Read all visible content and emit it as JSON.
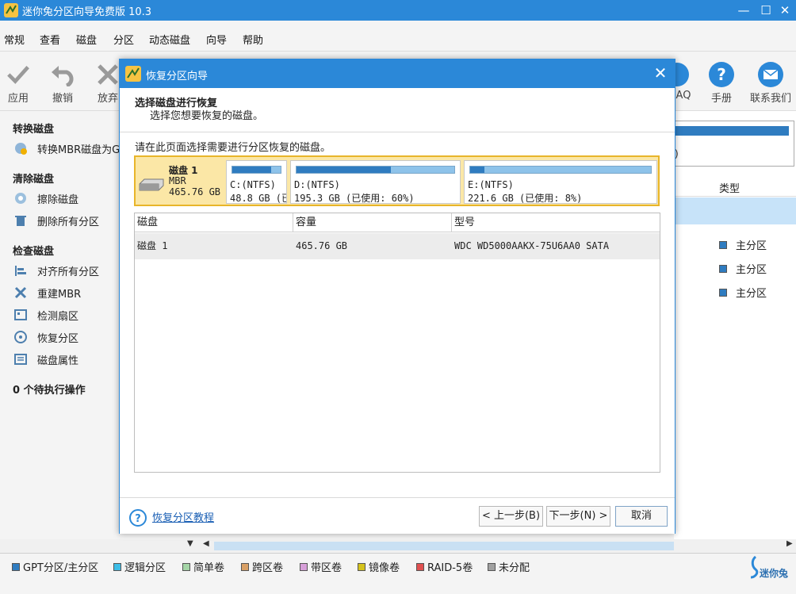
{
  "app": {
    "title": "迷你兔分区向导免费版 10.3"
  },
  "menu": [
    "常规",
    "查看",
    "磁盘",
    "分区",
    "动态磁盘",
    "向导",
    "帮助"
  ],
  "toolbar": {
    "apply": "应用",
    "undo": "撤销",
    "discard": "放弃",
    "faq": "AQ",
    "manual": "手册",
    "contact": "联系我们"
  },
  "sidebar": {
    "section_convert": "转换磁盘",
    "item_convert_mbr": "转换MBR磁盘为GPT",
    "section_clean": "清除磁盘",
    "item_wipe": "擦除磁盘",
    "item_delete_all": "删除所有分区",
    "section_check": "检查磁盘",
    "item_align": "对齐所有分区",
    "item_rebuild": "重建MBR",
    "item_surface": "检测扇区",
    "item_recover": "恢复分区",
    "item_props": "磁盘属性",
    "pending": "0 个待执行操作"
  },
  "right_panel": {
    "col_type": "类型",
    "size_fragment": ")",
    "rows": [
      "主分区",
      "主分区",
      "主分区"
    ]
  },
  "legend": [
    {
      "label": "GPT分区/主分区",
      "color": "#2f7cc0"
    },
    {
      "label": "逻辑分区",
      "color": "#3dbde6"
    },
    {
      "label": "简单卷",
      "color": "#a5d6a7"
    },
    {
      "label": "跨区卷",
      "color": "#d9a066"
    },
    {
      "label": "带区卷",
      "color": "#d79fd9"
    },
    {
      "label": "镜像卷",
      "color": "#d4c21c"
    },
    {
      "label": "RAID-5卷",
      "color": "#e05050"
    },
    {
      "label": "未分配",
      "color": "#a0a0a0"
    }
  ],
  "brand": "迷你兔",
  "dialog": {
    "title": "恢复分区向导",
    "heading": "选择磁盘进行恢复",
    "subheading": "选择您想要恢复的磁盘。",
    "instruction": "请在此页面选择需要进行分区恢复的磁盘。",
    "disk": {
      "name": "磁盘 1",
      "type": "MBR",
      "size": "465.76 GB",
      "partitions": [
        {
          "name": "C:(NTFS)",
          "info": "48.8 GB (已",
          "used_fraction": 0.8
        },
        {
          "name": "D:(NTFS)",
          "info": "195.3 GB (已使用: 60%)",
          "used_fraction": 0.6
        },
        {
          "name": "E:(NTFS)",
          "info": "221.6 GB (已使用: 8%)",
          "used_fraction": 0.08
        }
      ]
    },
    "table": {
      "headers": [
        "磁盘",
        "容量",
        "型号"
      ],
      "rows": [
        {
          "disk": "磁盘 1",
          "capacity": "465.76 GB",
          "model": "WDC WD5000AAKX-75U6AA0 SATA"
        }
      ]
    },
    "help_link": "恢复分区教程",
    "back": "< 上一步(B)",
    "next": "下一步(N) >",
    "cancel": "取消"
  }
}
